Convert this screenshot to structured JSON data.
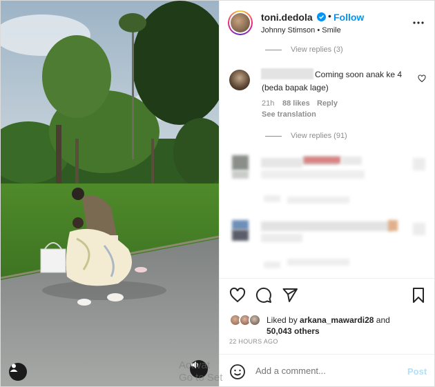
{
  "header": {
    "username": "toni.dedola",
    "separator": "•",
    "follow_label": "Follow",
    "audio": "Johnny Stimson • Smile"
  },
  "comments": {
    "view_replies_top": "View replies (3)",
    "comment": {
      "text_line1": "Coming soon anak ke 4",
      "text_line2": "(beda bapak lage)",
      "time": "21h",
      "likes": "88 likes",
      "reply_label": "Reply",
      "translate_label": "See translation",
      "view_replies": "View replies (91)"
    }
  },
  "likes": {
    "prefix": "Liked by",
    "user": "arkana_mawardi28",
    "and": "and",
    "count": "50,043 others"
  },
  "timestamp": "22 HOURS AGO",
  "add_comment": {
    "placeholder": "Add a comment...",
    "post_label": "Post"
  },
  "watermark": {
    "line1": "Activat",
    "line2": "Go to Set"
  },
  "colors": {
    "accent": "#0095f6",
    "post_disabled": "#b2dffc",
    "muted": "#8e8e8e"
  },
  "icons": [
    "verified-icon",
    "more-options-icon",
    "heart-icon",
    "comment-icon",
    "share-icon",
    "bookmark-icon",
    "emoji-icon",
    "user-tag-icon",
    "sound-icon"
  ]
}
